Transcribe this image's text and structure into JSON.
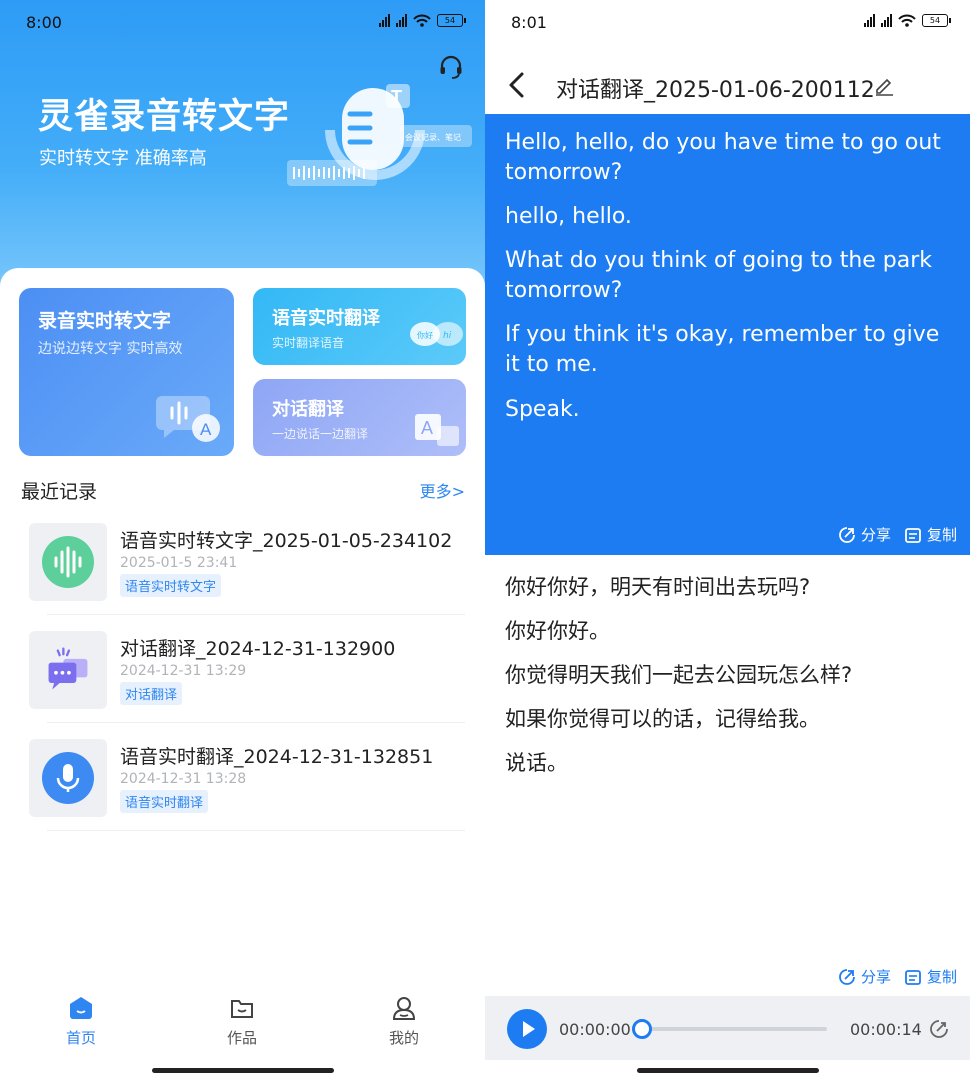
{
  "left": {
    "status": {
      "time": "8:00",
      "battery": "54"
    },
    "hero": {
      "title": "灵雀录音转文字",
      "subtitle": "实时转文字 准确率高",
      "illustration_tag": "会议记录、笔记"
    },
    "cards": [
      {
        "title": "录音实时转文字",
        "subtitle": "边说边转文字 实时高效",
        "icon": "sound-wave-a-icon"
      },
      {
        "title": "语音实时翻译",
        "subtitle": "实时翻译语音",
        "icon": "translate-bubbles-icon",
        "badge1": "你好",
        "badge2": "hi"
      },
      {
        "title": "对话翻译",
        "subtitle": "一边说话一边翻译",
        "icon": "dialogue-a-icon"
      }
    ],
    "recent": {
      "title": "最近记录",
      "more": "更多>",
      "items": [
        {
          "title": "语音实时转文字_2025-01-05-234102",
          "date": "2025-01-5 23:41",
          "tag": "语音实时转文字",
          "icon": "sound-wave-icon",
          "color": "#5ccf9a"
        },
        {
          "title": "对话翻译_2024-12-31-132900",
          "date": "2024-12-31 13:29",
          "tag": "对话翻译",
          "icon": "chat-bubbles-icon",
          "color": "#7b6ff0"
        },
        {
          "title": "语音实时翻译_2024-12-31-132851",
          "date": "2024-12-31 13:28",
          "tag": "语音实时翻译",
          "icon": "microphone-icon",
          "color": "#3d8bf2"
        }
      ]
    },
    "tabs": [
      {
        "label": "首页",
        "icon": "home-icon",
        "active": true
      },
      {
        "label": "作品",
        "icon": "folder-icon",
        "active": false
      },
      {
        "label": "我的",
        "icon": "profile-icon",
        "active": false
      }
    ]
  },
  "right": {
    "status": {
      "time": "8:01",
      "battery": "54"
    },
    "nav": {
      "title": "对话翻译_2025-01-06-200112"
    },
    "english_lines": [
      "Hello, hello, do you have time to go out tomorrow?",
      "hello, hello.",
      "What do you think of going to the park tomorrow?",
      "If you think it's okay, remember to give it to me.",
      "Speak."
    ],
    "chinese_lines": [
      "你好你好，明天有时间出去玩吗?",
      "你好你好。",
      "你觉得明天我们一起去公园玩怎么样?",
      "如果你觉得可以的话，记得给我。",
      "说话。"
    ],
    "actions": {
      "share": "分享",
      "copy": "复制"
    },
    "player": {
      "current": "00:00:00",
      "total": "00:00:14",
      "progress": 0
    }
  },
  "colors": {
    "primary": "#1d7cf2",
    "hero_top": "#2e9bf6",
    "tag_bg": "#e6f1fd"
  }
}
